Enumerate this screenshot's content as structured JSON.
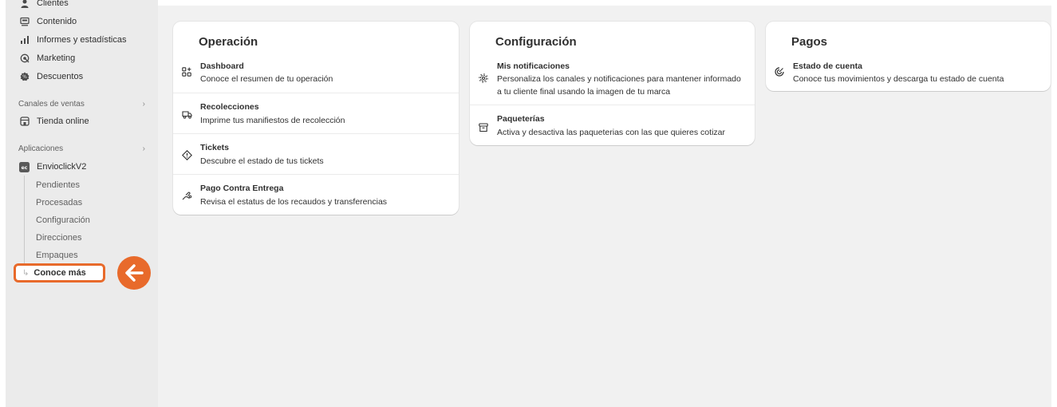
{
  "sidebar": {
    "items_top": [
      {
        "label": "Clientes",
        "icon": "person-icon"
      },
      {
        "label": "Contenido",
        "icon": "content-icon"
      },
      {
        "label": "Informes y estadísticas",
        "icon": "bar-chart-icon"
      },
      {
        "label": "Marketing",
        "icon": "marketing-icon"
      },
      {
        "label": "Descuentos",
        "icon": "discount-icon"
      }
    ],
    "sales_channels": {
      "header": "Canales de ventas",
      "item": "Tienda online"
    },
    "apps": {
      "header": "Aplicaciones",
      "app_name": "EnvioclickV2",
      "subitems": [
        "Pendientes",
        "Procesadas",
        "Configuración",
        "Direcciones",
        "Empaques"
      ],
      "active": "Conoce más"
    }
  },
  "cards": {
    "operacion": {
      "title": "Operación",
      "rows": [
        {
          "title": "Dashboard",
          "desc": "Conoce el resumen de tu operación",
          "icon": "dashboard-icon"
        },
        {
          "title": "Recolecciones",
          "desc": "Imprime tus manifiestos de recolección",
          "icon": "truck-icon"
        },
        {
          "title": "Tickets",
          "desc": "Descubre el estado de tus tickets",
          "icon": "ticket-icon"
        },
        {
          "title": "Pago Contra Entrega",
          "desc": "Revisa el estatus de los recaudos y transferencias",
          "icon": "hand-money-icon"
        }
      ]
    },
    "configuracion": {
      "title": "Configuración",
      "rows": [
        {
          "title": "Mis notificaciones",
          "desc": "Personaliza los canales y notificaciones para mantener informado a tu cliente final usando la imagen de tu marca",
          "icon": "gear-icon"
        },
        {
          "title": "Paqueterías",
          "desc": "Activa y desactiva las paqueterias con las que quieres cotizar",
          "icon": "archive-icon"
        }
      ]
    },
    "pagos": {
      "title": "Pagos",
      "rows": [
        {
          "title": "Estado de cuenta",
          "desc": "Conoce tus movimientos y descarga tu estado de cuenta",
          "icon": "statement-icon"
        }
      ]
    }
  },
  "colors": {
    "accent": "#e86a2b",
    "sidebar_bg": "#ebebeb",
    "content_bg": "#f1f1f1"
  }
}
